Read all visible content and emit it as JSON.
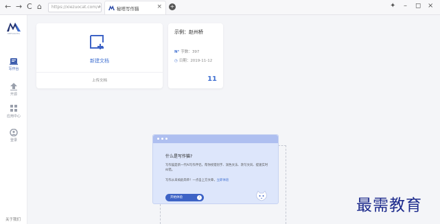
{
  "browser": {
    "url": "https://xiezuocat.com/#/",
    "tab_title": "秘塔写作猫",
    "tab_close": "×",
    "new_tab": "+",
    "nav_back": "←",
    "nav_forward": "→",
    "nav_reload": "C",
    "nav_home": "⌂",
    "win_pin": "✦",
    "win_min": "–",
    "win_max": "◻",
    "win_close": "×"
  },
  "sidebar": {
    "logo_text": "METASOTA",
    "items": [
      {
        "label": "写作台",
        "icon": "document-icon",
        "active": true
      },
      {
        "label": "开源",
        "icon": "upload-icon",
        "active": false
      },
      {
        "label": "应用中心",
        "icon": "grid-icon",
        "active": false
      },
      {
        "label": "登录",
        "icon": "user-icon",
        "active": false
      }
    ],
    "about": "关于我们"
  },
  "cards": {
    "new_doc": {
      "label": "新建文档",
      "upload": "上传文档"
    },
    "example": {
      "title": "示例：赵州桥",
      "words_label": "字数：397",
      "date_label": "日期：2019-11-12",
      "count": "11"
    }
  },
  "guide": {
    "title": "什么是写作猫?",
    "desc": "写作猫是新一代AI写作伴侣，帮你找错别字、润色文法、改写文风、提速实时纠错。",
    "try_text": "写作从未如此简单！一点击上方文章，",
    "try_link": "立即体验",
    "start_label": "开始体验",
    "start_arrow": "›"
  },
  "watermark": "最需教育",
  "colors": {
    "accent": "#3f6fd1",
    "button": "#3d63c6",
    "popup_bg": "#dde6fb",
    "watermark": "#1c2a8c"
  }
}
